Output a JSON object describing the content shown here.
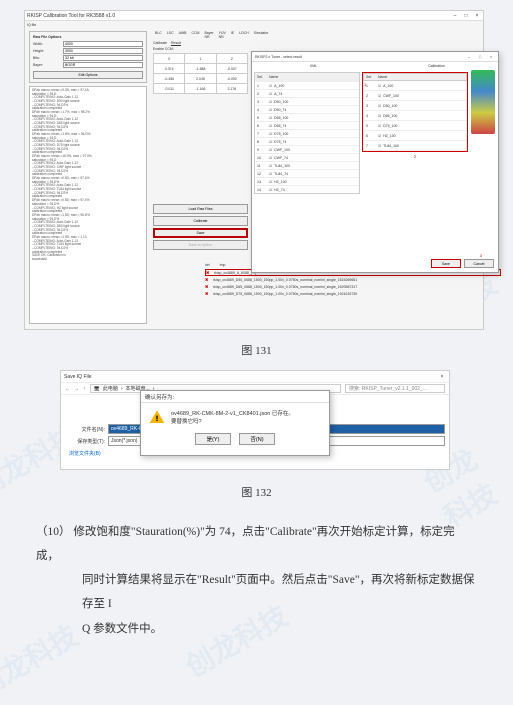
{
  "fig131": {
    "window_title": "RKISP Calibration Tool for RK3588 v1.0",
    "menubar": [
      "BLC",
      "LSC",
      "AWB",
      "CCM",
      "Bayer-NR",
      "YUV-NR",
      "IE",
      "LDCH",
      "Simulator"
    ],
    "raw_options": {
      "label": "Raw File Options",
      "width_label": "Width:",
      "width_value": "4000",
      "height_label": "Height:",
      "height_value": "3000",
      "bits_label": "Bits:",
      "bits_value": "32 bit",
      "bayer_label": "Bayer:",
      "bayer_value": "BGGR",
      "edit_btn": "Edit Options"
    },
    "log_lines": [
      "DPab macro: mean =0.3D; max = 97.4A",
      "saturation = 94.D",
      "--COMPLTEING: Auto-Gain 1.13",
      "--COMPLTEING: D50 light source",
      "--COMPLTEING: 94.D2%",
      "calibration completed",
      "DPab macro: mean =1.7%, max = 98.2%",
      "saturation = 94.D",
      "--COMPLTEING: Auto-Gain 1.12",
      "--COMPLTEING: D65 light source",
      "--COMPLTEING: 94.D2%",
      "calibration completed",
      "DPab macro: mean =1.8%; max = 96.D%",
      "saturation = 94.D",
      "--COMPLTEING: Auto-Gain 1.13",
      "--COMPLTEING: D75 light source",
      "--COMPLTEING: 94.D2%",
      "calibration completed",
      "DPab macro: mean =16.9%, max = 97.5%",
      "saturation = 94.D",
      "--COMPLTEING: Auto-Gain 1.12",
      "--COMPLTEING: CWF light source",
      "--COMPLTEING: 94.D2%",
      "calibration completed",
      "DPab macro: mean =0.5D; max = 97.4%",
      "saturation = 94.D%",
      "--COMPLTEING: Auto-Gain 1.12",
      "--COMPLTEING: TL84 light source",
      "--COMPLTEING: 94.D2%",
      "calibration completed",
      "DPab macro: mean =0.5D; max = 97.4%",
      "saturation = 94.D%",
      "--COMPLTEING: HZ light source",
      "calibration completed",
      "DPab macro: mean =1.5D; max = 96.D%",
      "saturation = 94.D%",
      "--COMPLTEING: Auto-Gain 1.12",
      "--COMPLTEING: D50 light source",
      "--COMPLTEING: 94.D2%",
      "calibration completed",
      "DPab macro: mean =1.9D; max = 1.13",
      "--COMPLTEING: Auto-Gain 1.13",
      "--COMPLTEING: TL84 light source",
      "--COMPLTEING: 94.D2%",
      "calibration completed",
      "SAVE DK: Calibration is",
      "successful"
    ],
    "tabs": [
      "BLC",
      "LSC",
      "AWB",
      "CCM",
      "Bayer NR",
      "YUV NR",
      "IE",
      "LDCH",
      "Simulator"
    ],
    "subtabs": [
      "Calibrate",
      "Result"
    ],
    "ccm_label": "Enable CCM:",
    "ccm": [
      [
        "0",
        "1",
        "2"
      ],
      [
        "0.374",
        "-1.588",
        "-0.007"
      ],
      [
        "-0.456",
        "2.045",
        "-0.092"
      ],
      [
        "-0.011",
        "-1.166",
        "3.176"
      ]
    ],
    "btn_load": "Load Raw Files",
    "btn_calibrate": "Calibrate",
    "btn_save": "Save",
    "btn_back": "Back to Option",
    "filelist_hdr": [
      "del",
      "tmp"
    ],
    "filelist": [
      "rkisp_ov4689_A_6088_[...]",
      "rkisp_ov4689_D50_0688_1500_150pp_1.00x_0.0750s_nominal_nominl_single_1524269651",
      "rkisp_ov4689_D65_0688_1500_150pp_1.00x_0.0750s_nominal_nominl_single_1520587317",
      "rkisp_ov4689_D75_0688_1500_150pp_1.00x_0.0750s_nominal_nominl_single_1921615730"
    ],
    "modal": {
      "title": "RKISP2.x Tuner - select result",
      "tab_xml": "XML",
      "tab_cal": "Calibration",
      "list_hdr_sel": "Sel.",
      "list_hdr_name": "Name",
      "left": [
        "A_100",
        "A_74",
        "D50_100",
        "D50_74",
        "D65_100",
        "D65_74",
        "D75_100",
        "D75_74",
        "CWF_100",
        "CWF_74",
        "TL84_100",
        "TL84_74",
        "HZ_100",
        "HZ_74"
      ],
      "right": [
        "A_100",
        "CWF_100",
        "D50_100",
        "D65_100",
        "D75_100",
        "HZ_100",
        "TL84_100"
      ],
      "btn_save": "Save",
      "btn_cancel": "Cancel",
      "anno1": "1",
      "anno2": "2",
      "anno3": "3"
    }
  },
  "caption131": "图 131",
  "fig132": {
    "window_title": "Save IQ File",
    "crumb_prefix": "此电脑",
    "crumb_item": "本地磁盘...",
    "search_placeholder": "搜索: RKISP_Tuner_v2.1.1_002_...",
    "filename_label": "文件名(N):",
    "filename_value": "ov4689_RK-CMK-8M-2-v1_CK8401",
    "filetype_label": "保存类型(T):",
    "filetype_value": "Json(*.json)",
    "browse_label": "浏览文件夹(B)",
    "confirm": {
      "title": "确认另存为:",
      "line1": "ov4689_RK-CMK-8M-2-v1_CK8401.json 已存在。",
      "line2": "要替换它吗?",
      "yes": "是(Y)",
      "no": "否(N)"
    }
  },
  "caption132": "图 132",
  "step": {
    "num": "（10）",
    "text1": "修改饱和度\"Stauration(%)\"为 74，点击\"Calibrate\"再次开始标定计算，标定完成，",
    "text2": "同时计算结果将显示在\"Result\"页面中。然后点击\"Save\"，再次将新标定数据保存至 I",
    "text3": "Q 参数文件中。"
  }
}
